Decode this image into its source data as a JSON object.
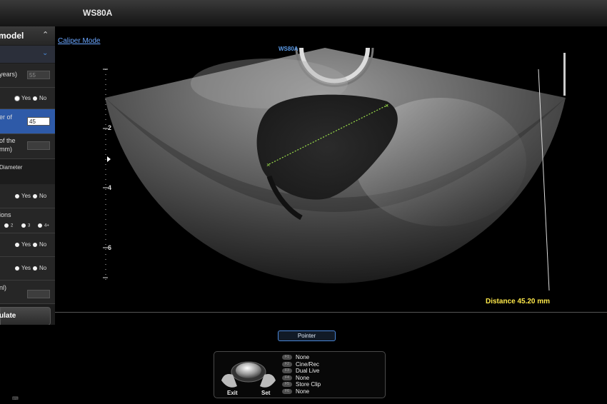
{
  "app": {
    "title": "WS80A"
  },
  "panel": {
    "header": "model",
    "rows": [
      {
        "label": "years)",
        "input_value": "55"
      },
      {
        "options": [
          "Yes",
          "No"
        ]
      },
      {
        "label_line1": "er of",
        "input_value": "45"
      },
      {
        "label_line1": "of the",
        "label_line2": "mm)"
      },
      {
        "label": "Diameter"
      },
      {
        "options": [
          "Yes",
          "No"
        ]
      },
      {
        "label": "ions",
        "options": [
          "2",
          "3",
          "4+"
        ]
      },
      {
        "options": [
          "Yes",
          "No"
        ]
      },
      {
        "options": [
          "Yes",
          "No"
        ]
      },
      {
        "label": "nl)"
      }
    ],
    "calculate_label": "ulate"
  },
  "image": {
    "mode_link": "Caliper Mode",
    "probe_label": "WS80A",
    "depth_marks": [
      "2",
      "4",
      "6"
    ],
    "measurement": "Distance 45.20 mm"
  },
  "controls": {
    "pointer_label": "Pointer",
    "exit_label": "Exit",
    "set_label": "Set",
    "softkeys": [
      {
        "key": "F1",
        "label": "None"
      },
      {
        "key": "F2",
        "label": "Cine/Rec"
      },
      {
        "key": "F3",
        "label": "Dual Live"
      },
      {
        "key": "F4",
        "label": "None"
      },
      {
        "key": "F5",
        "label": "Store Clip"
      },
      {
        "key": "F6",
        "label": "None"
      }
    ]
  },
  "colors": {
    "accent": "#2e5aa8",
    "measurement": "#ffe94a",
    "link": "#6aa6ff"
  }
}
